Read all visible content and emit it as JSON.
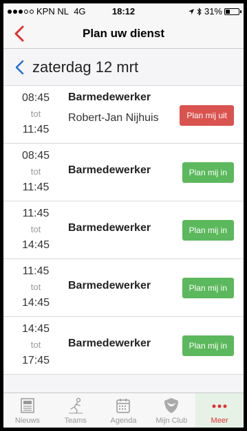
{
  "status": {
    "carrier": "KPN NL",
    "network": "4G",
    "time": "18:12",
    "battery": "31%",
    "battery_level": 0.31
  },
  "header": {
    "title": "Plan uw dienst"
  },
  "date_label": "zaterdag 12 mrt",
  "shifts": [
    {
      "start": "08:45",
      "sep": "tot",
      "end": "11:45",
      "role": "Barmedewerker",
      "person": "Robert-Jan Nijhuis",
      "action": "Plan mij uit",
      "action_type": "remove"
    },
    {
      "start": "08:45",
      "sep": "tot",
      "end": "11:45",
      "role": "Barmedewerker",
      "person": "",
      "action": "Plan mij in",
      "action_type": "add"
    },
    {
      "start": "11:45",
      "sep": "tot",
      "end": "14:45",
      "role": "Barmedewerker",
      "person": "",
      "action": "Plan mij in",
      "action_type": "add"
    },
    {
      "start": "11:45",
      "sep": "tot",
      "end": "14:45",
      "role": "Barmedewerker",
      "person": "",
      "action": "Plan mij in",
      "action_type": "add"
    },
    {
      "start": "14:45",
      "sep": "tot",
      "end": "17:45",
      "role": "Barmedewerker",
      "person": "",
      "action": "Plan mij in",
      "action_type": "add"
    }
  ],
  "tabs": [
    {
      "label": "Nieuws",
      "icon": "newspaper-icon",
      "active": false
    },
    {
      "label": "Teams",
      "icon": "player-icon",
      "active": false
    },
    {
      "label": "Agenda",
      "icon": "calendar-icon",
      "active": false
    },
    {
      "label": "Mijn Club",
      "icon": "shield-icon",
      "active": false
    },
    {
      "label": "Meer",
      "icon": "more-icon",
      "active": true
    }
  ],
  "colors": {
    "accent": "#e0312f",
    "remove_button": "#d9534f",
    "add_button": "#5cb85c",
    "link_blue": "#1e6fd9"
  }
}
